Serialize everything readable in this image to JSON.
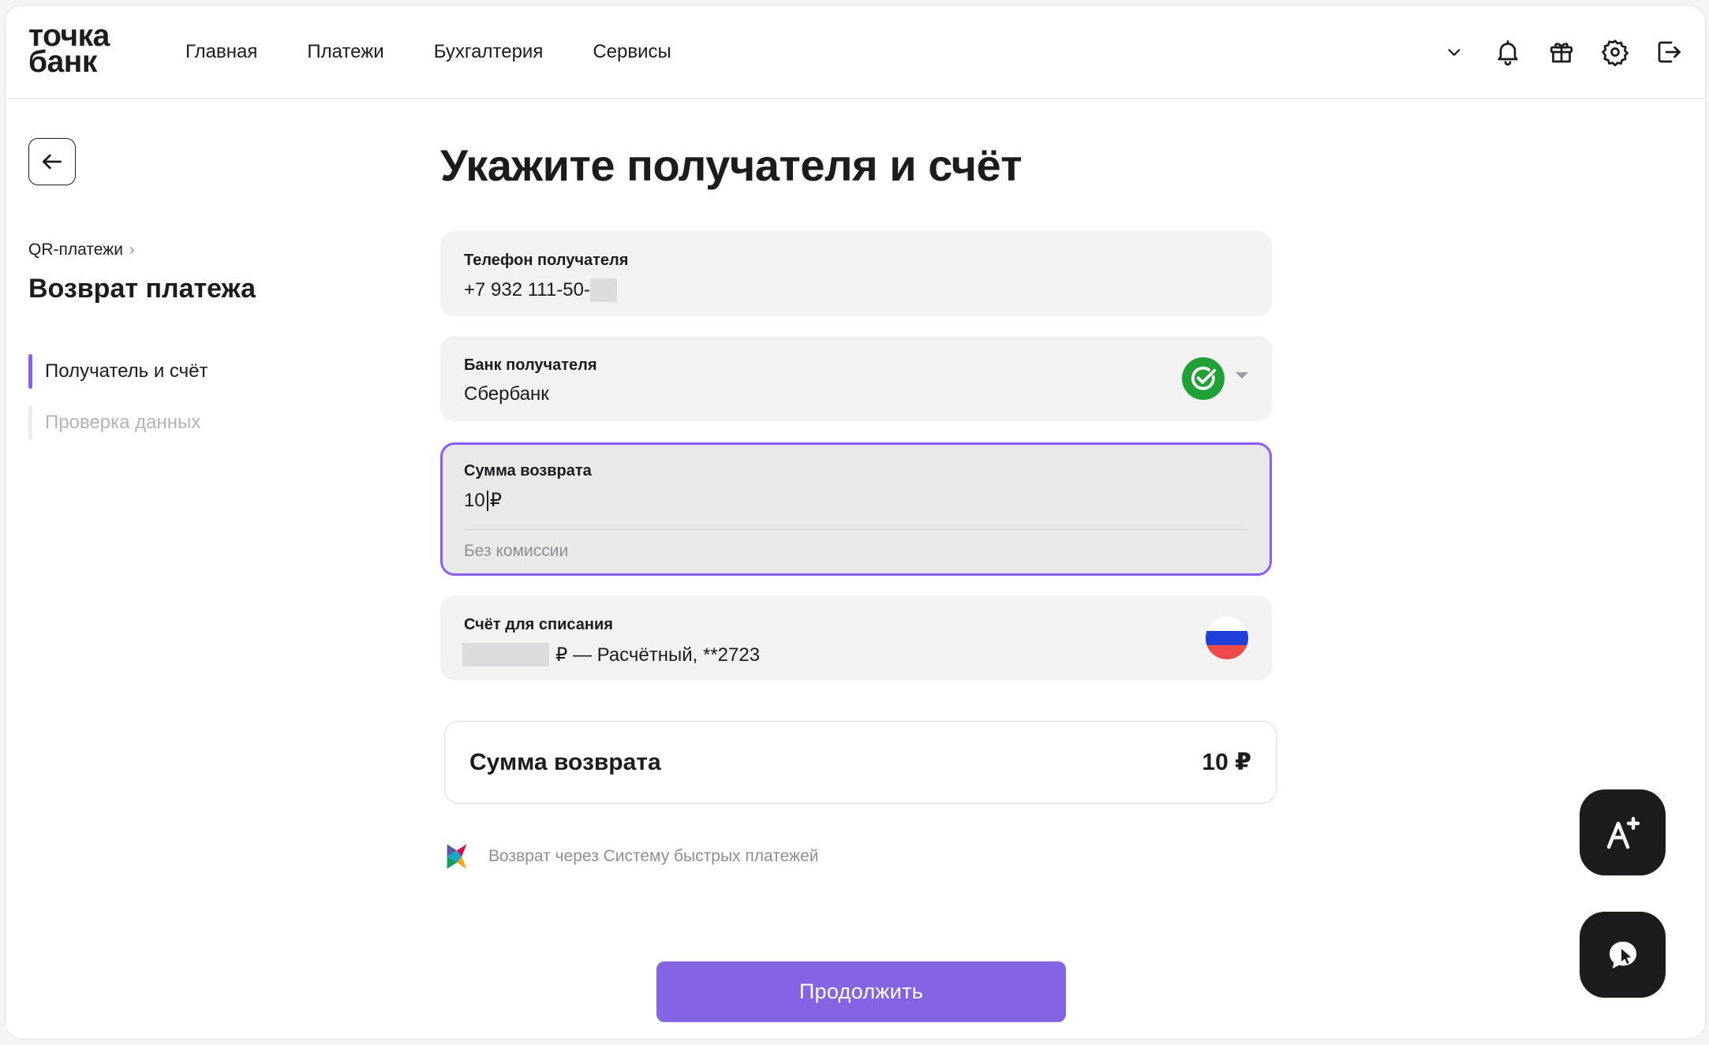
{
  "header": {
    "logo_line1": "точка",
    "logo_line2": "банк",
    "nav": [
      "Главная",
      "Платежи",
      "Бухгалтерия",
      "Сервисы"
    ],
    "icons": [
      "chevron-down-icon",
      "bell-icon",
      "gift-icon",
      "gear-icon",
      "logout-icon"
    ]
  },
  "sidebar": {
    "breadcrumb": "QR-платежи",
    "title": "Возврат платежа",
    "steps": [
      {
        "label": "Получатель и счёт",
        "active": true
      },
      {
        "label": "Проверка данных",
        "active": false
      }
    ]
  },
  "main": {
    "title": "Укажите получателя и счёт",
    "phone": {
      "label": "Телефон получателя",
      "value": "+7 932 111-50-"
    },
    "bank": {
      "label": "Банк получателя",
      "value": "Сбербанк"
    },
    "amount": {
      "label": "Сумма возврата",
      "value": "10",
      "currency": "₽",
      "hint": "Без комиссии"
    },
    "account": {
      "label": "Счёт для списания",
      "value": "₽ — Расчётный, **2723"
    },
    "summary": {
      "label": "Сумма возврата",
      "value": "10 ₽"
    },
    "sbp_text": "Возврат через Систему быстрых платежей",
    "continue_label": "Продолжить"
  },
  "colors": {
    "accent": "#8b5cf6",
    "button": "#8464e2",
    "sber_green": "#21a038"
  }
}
